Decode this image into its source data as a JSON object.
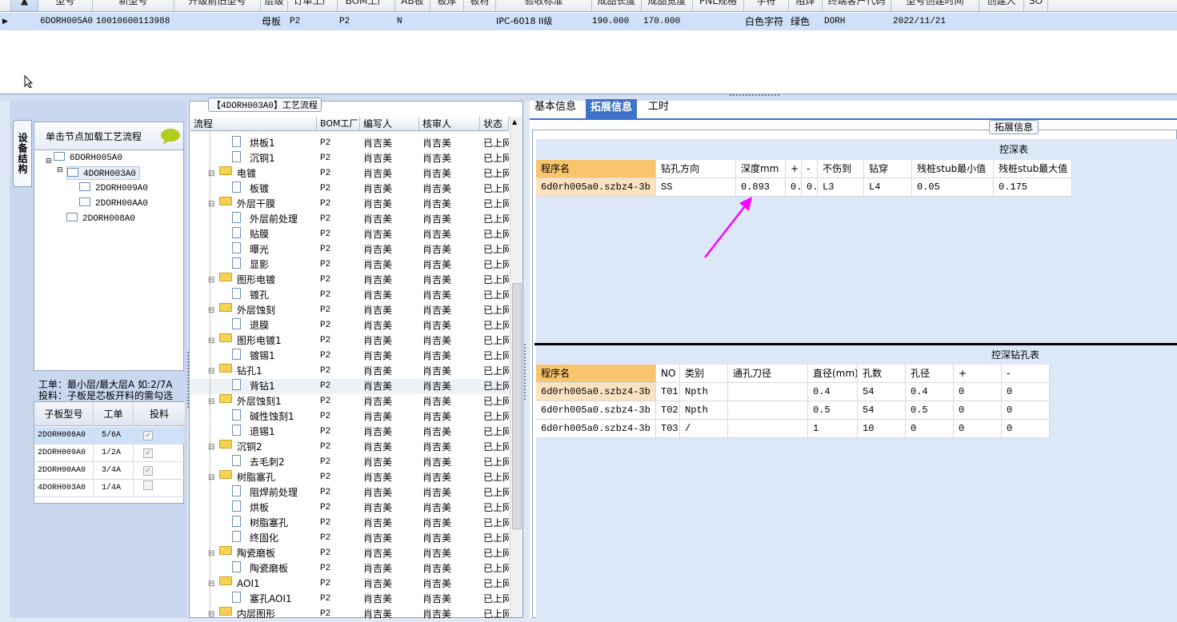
{
  "top_grid": {
    "headers": [
      "型号",
      "新型号",
      "升级前旧型号",
      "层级",
      "订单工厂",
      "BOM工厂",
      "AB板",
      "板厚",
      "板材",
      "验收标准",
      "成品长度",
      "成品宽度",
      "PNL规格",
      "字符",
      "阻焊",
      "终端客户代码",
      "型号创建时间",
      "创建人",
      "SO"
    ],
    "row": {
      "model": "6DORH005A0",
      "new_model": "10010600113988",
      "layer": "母板",
      "order_factory": "P2",
      "bom_factory": "P2",
      "ab": "N",
      "standard": "IPC-6018 II级",
      "length": "190.000",
      "width": "170.000",
      "char": "白色字符",
      "mask": "绿色",
      "customer": "DORH",
      "created": "2022/11/21"
    }
  },
  "left": {
    "vertical_tab": "设备结构",
    "hint": "单击节点加载工艺流程",
    "tree": [
      "6DORH005A0",
      "4DORH003A0",
      "2DORH009A0",
      "2DORH00AA0",
      "2DORH008A0"
    ],
    "note1": "工单：最小层/最大层A 如:2/7A",
    "note2": "投料：子板是芯板开料的需勾选",
    "sub_headers": [
      "子板型号",
      "工单",
      "投料"
    ],
    "sub_rows": [
      {
        "model": "2DORH008A0",
        "order": "5/6A",
        "checked": "✓"
      },
      {
        "model": "2DORH009A0",
        "order": "1/2A",
        "checked": "✓"
      },
      {
        "model": "2DORH00AA0",
        "order": "3/4A",
        "checked": "✓"
      },
      {
        "model": "4DORH003A0",
        "order": "1/4A",
        "checked": ""
      }
    ]
  },
  "middle": {
    "title": "【4DORH003A0】工艺流程",
    "headers": [
      "流程",
      "BOM工厂",
      "编写人",
      "核审人",
      "状态"
    ],
    "factory": "P2",
    "writer": "肖吉美",
    "reviewer": "肖吉美",
    "status": "已上网",
    "rows": [
      {
        "n": "烘板1",
        "f": false
      },
      {
        "n": "沉铜1",
        "f": false
      },
      {
        "n": "电镀",
        "f": true
      },
      {
        "n": "板镀",
        "f": false
      },
      {
        "n": "外层干膜",
        "f": true
      },
      {
        "n": "外层前处理",
        "f": false
      },
      {
        "n": "贴膜",
        "f": false
      },
      {
        "n": "曝光",
        "f": false
      },
      {
        "n": "显影",
        "f": false
      },
      {
        "n": "图形电镀",
        "f": true
      },
      {
        "n": "镀孔",
        "f": false
      },
      {
        "n": "外层蚀刻",
        "f": true
      },
      {
        "n": "退膜",
        "f": false
      },
      {
        "n": "图形电镀1",
        "f": true
      },
      {
        "n": "镀锡1",
        "f": false
      },
      {
        "n": "钻孔1",
        "f": true
      },
      {
        "n": "背钻1",
        "f": false
      },
      {
        "n": "外层蚀刻1",
        "f": true
      },
      {
        "n": "碱性蚀刻1",
        "f": false
      },
      {
        "n": "退锡1",
        "f": false
      },
      {
        "n": "沉铜2",
        "f": true
      },
      {
        "n": "去毛刺2",
        "f": false
      },
      {
        "n": "树脂塞孔",
        "f": true
      },
      {
        "n": "阻焊前处理",
        "f": false
      },
      {
        "n": "烘板",
        "f": false
      },
      {
        "n": "树脂塞孔",
        "f": false
      },
      {
        "n": "终固化",
        "f": false
      },
      {
        "n": "陶瓷磨板",
        "f": true
      },
      {
        "n": "陶瓷磨板",
        "f": false
      },
      {
        "n": "AOI1",
        "f": true
      },
      {
        "n": "塞孔AOI1",
        "f": false
      },
      {
        "n": "内层图形",
        "f": true
      }
    ]
  },
  "right": {
    "tabs": [
      "基本信息",
      "拓展信息",
      "工时"
    ],
    "group_title": "拓展信息",
    "t1_title": "控深表",
    "t1_headers": [
      "程序名",
      "钻孔方向",
      "深度mm",
      "+",
      "-",
      "不伤到",
      "钻穿",
      "残桩stub最小值",
      "残桩stub最大值"
    ],
    "t1_row": [
      "6d0rh005a0.szbz4-3b",
      "SS",
      "0.893",
      "0.",
      "0.",
      "L3",
      "L4",
      "0.05",
      "0.175"
    ],
    "t2_title": "控深钻孔表",
    "t2_headers": [
      "程序名",
      "NO",
      "类别",
      "通孔刀径",
      "直径(mm)",
      "孔数",
      "孔径",
      "+",
      "-"
    ],
    "t2_rows": [
      [
        "6d0rh005a0.szbz4-3b",
        "T01",
        "Npth",
        "",
        "0.4",
        "54",
        "0.4",
        "0",
        "0"
      ],
      [
        "6d0rh005a0.szbz4-3b",
        "T02",
        "Npth",
        "",
        "0.5",
        "54",
        "0.5",
        "0",
        "0"
      ],
      [
        "6d0rh005a0.szbz4-3b",
        "T03",
        "/",
        "",
        "1",
        "10",
        "0",
        "0",
        "0"
      ]
    ],
    "accent": "#ff00ff"
  }
}
